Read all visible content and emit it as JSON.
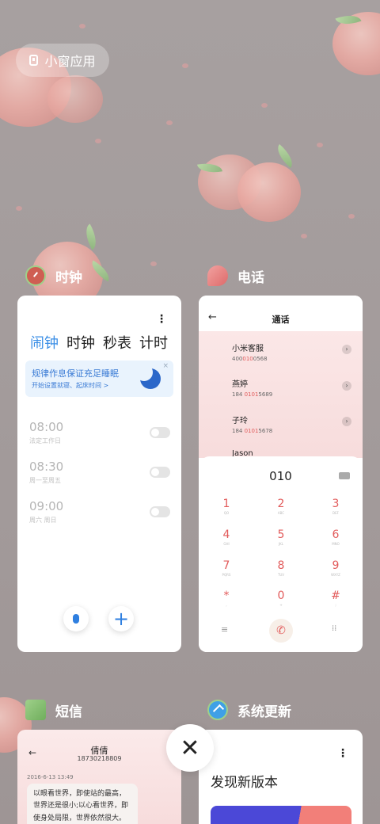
{
  "float_button": {
    "label": "小窗应用",
    "icon": "floating-window-icon"
  },
  "clock": {
    "app_name": "时钟",
    "tabs": [
      "闹钟",
      "时钟",
      "秒表",
      "计时"
    ],
    "active_tab": "闹钟",
    "banner": {
      "title": "规律作息保证充足睡眠",
      "subtitle": "开始设置就寝、起床时间 >",
      "close": "×"
    },
    "alarms": [
      {
        "time": "08:00",
        "repeat": "法定工作日"
      },
      {
        "time": "08:30",
        "repeat": "周一至周五"
      },
      {
        "time": "09:00",
        "repeat": "周六 周日"
      }
    ],
    "more": "⋮",
    "add": "+"
  },
  "phone": {
    "app_name": "电话",
    "title": "通话",
    "back": "←",
    "contacts": [
      {
        "name": "小米客服",
        "num_pre": "400",
        "num_hl": "010",
        "num_post": "0568"
      },
      {
        "name": "燕婷",
        "num_pre": "184 ",
        "num_hl": "0101",
        "num_post": "5689"
      },
      {
        "name": "子玲",
        "num_pre": "184 ",
        "num_hl": "0101",
        "num_post": "5678"
      },
      {
        "name": "Jason",
        "num_pre": "",
        "num_hl": "",
        "num_post": ""
      }
    ],
    "dial_digits": "010",
    "keys": [
      {
        "n": "1",
        "l": "QO"
      },
      {
        "n": "2",
        "l": "ABC"
      },
      {
        "n": "3",
        "l": "DEF"
      },
      {
        "n": "4",
        "l": "GHI"
      },
      {
        "n": "5",
        "l": "JKL"
      },
      {
        "n": "6",
        "l": "MNO"
      },
      {
        "n": "7",
        "l": "PQRS"
      },
      {
        "n": "8",
        "l": "TUV"
      },
      {
        "n": "9",
        "l": "WXYZ"
      },
      {
        "n": "*",
        "l": ","
      },
      {
        "n": "0",
        "l": "+"
      },
      {
        "n": "#",
        "l": ";"
      }
    ],
    "menu": "≡",
    "grid": "⁞⁞"
  },
  "sms": {
    "app_name": "短信",
    "contact": "倩倩",
    "number": "18730218809",
    "date": "2016-6-13 13:49",
    "message": "以眼看世界，即使站的最高，世界还是很小;以心看世界，即使身处局限，世界依然很大。生活远不完美，需要用心去体会，而不是专注于缺憾。"
  },
  "update": {
    "app_name": "系统更新",
    "title": "发现新版本",
    "more": "⋮"
  },
  "close_all": "✕",
  "colors": {
    "accent": "#3a8ee6",
    "dial": "#e25b5b"
  }
}
